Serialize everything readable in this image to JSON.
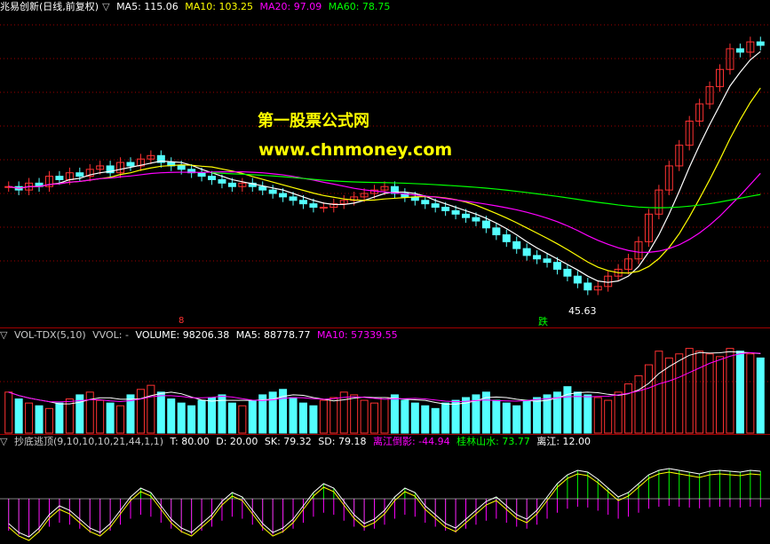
{
  "price_legend": {
    "title": "兆易创新(日线,前复权)",
    "ma5": "MA5: 115.06",
    "ma10": "MA10: 103.25",
    "ma20": "MA20: 97.09",
    "ma60": "MA60: 78.75"
  },
  "watermark": {
    "line1": "第一股票公式网",
    "line2": "www.chnmoney.com"
  },
  "annotations": {
    "low_price": "45.63",
    "down_label": "跌",
    "marker": "8"
  },
  "volume_legend": {
    "name": "VOL-TDX(5,10)",
    "vvol": "VVOL: -",
    "volume": "VOLUME: 98206.38",
    "ma5": "MA5: 88778.77",
    "ma10": "MA10: 57339.55"
  },
  "indicator_legend": {
    "name": "抄底逃顶(9,10,10,10,21,44,1,1)",
    "t": "T: 80.00",
    "d": "D: 20.00",
    "sk": "SK: 79.32",
    "sd": "SD: 79.18",
    "lj": "离江倒影: -44.94",
    "gl": "桂林山水: 73.77",
    "jiang": "离江: 12.00"
  },
  "colors": {
    "up": "#ff3232",
    "down": "#54ffff",
    "ma5": "#ffffff",
    "ma10": "#ffff00",
    "ma20": "#ff00ff",
    "ma60": "#00ff00",
    "grid": "#a00000"
  },
  "chart_data": {
    "type": "candlestick",
    "price": {
      "close": [
        76,
        75,
        77,
        76,
        79,
        78,
        80,
        79,
        81,
        82,
        80,
        83,
        82,
        84,
        85,
        83,
        82,
        81,
        80,
        79,
        78,
        77,
        76,
        77,
        76,
        75,
        74,
        73,
        72,
        71,
        70,
        70,
        71,
        72,
        73,
        74,
        75,
        76,
        74,
        73,
        72,
        71,
        70,
        69,
        68,
        67,
        66,
        64,
        62,
        60,
        58,
        56,
        55,
        54,
        52,
        50,
        48,
        46,
        47,
        50,
        52,
        55,
        60,
        68,
        75,
        82,
        88,
        95,
        100,
        105,
        110,
        116,
        115,
        118,
        117
      ],
      "low_point": 45.63
    },
    "volume": {
      "values": [
        30,
        25,
        22,
        20,
        18,
        22,
        25,
        28,
        30,
        24,
        22,
        20,
        28,
        32,
        35,
        30,
        25,
        22,
        20,
        24,
        26,
        28,
        22,
        20,
        24,
        28,
        30,
        32,
        26,
        22,
        20,
        24,
        26,
        30,
        28,
        24,
        22,
        26,
        28,
        24,
        22,
        20,
        18,
        22,
        24,
        26,
        28,
        30,
        24,
        22,
        20,
        24,
        26,
        28,
        30,
        34,
        30,
        28,
        26,
        24,
        30,
        36,
        42,
        50,
        60,
        55,
        58,
        62,
        60,
        58,
        56,
        62,
        60,
        58,
        55
      ]
    },
    "indicator": {
      "values": [
        20,
        10,
        5,
        15,
        30,
        40,
        35,
        25,
        15,
        10,
        20,
        35,
        50,
        60,
        55,
        40,
        25,
        15,
        10,
        20,
        30,
        45,
        55,
        50,
        35,
        20,
        10,
        15,
        25,
        40,
        55,
        65,
        60,
        45,
        30,
        20,
        25,
        35,
        50,
        60,
        55,
        40,
        30,
        20,
        15,
        25,
        35,
        45,
        50,
        40,
        30,
        25,
        35,
        50,
        65,
        75,
        80,
        78,
        70,
        60,
        50,
        55,
        65,
        75,
        80,
        82,
        80,
        78,
        76,
        79,
        80,
        79,
        78,
        80,
        79
      ]
    }
  }
}
